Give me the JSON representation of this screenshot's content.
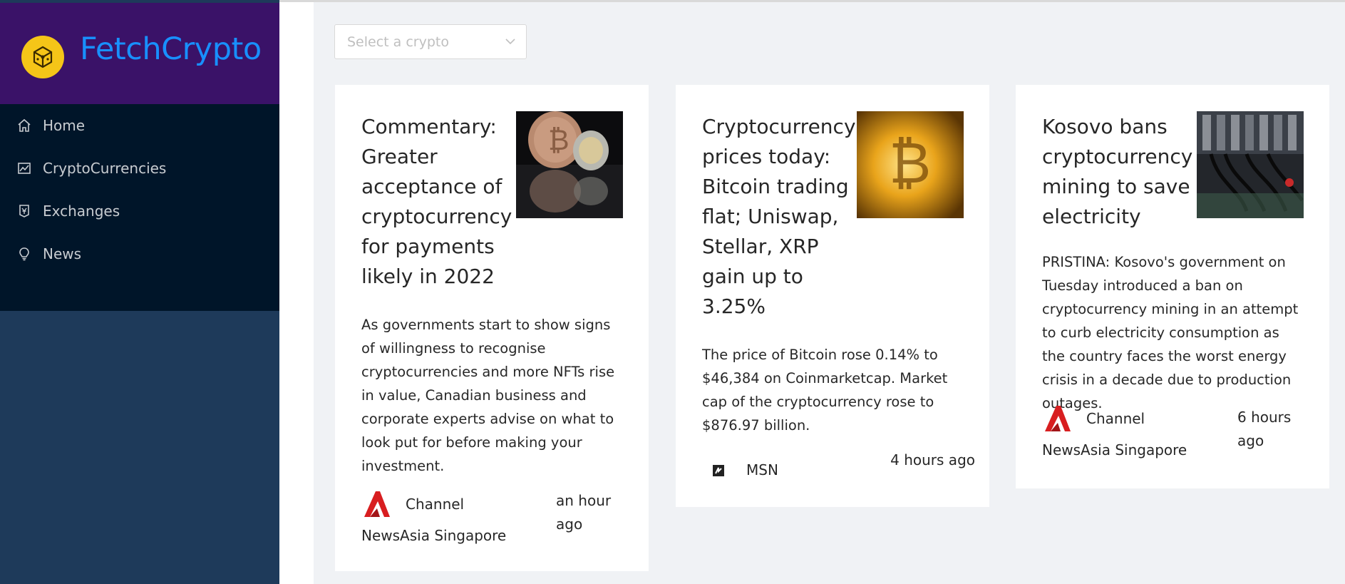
{
  "app": {
    "title": "FetchCrypto"
  },
  "colors": {
    "accent": "#1890ff",
    "logo_bg": "#3a1268",
    "menu_bg": "#001529",
    "sidebar_bg": "#1e3a5a",
    "logo_icon": "#f5c518"
  },
  "sidebar": {
    "items": [
      {
        "label": "Home",
        "icon": "home-icon"
      },
      {
        "label": "CryptoCurrencies",
        "icon": "fund-icon"
      },
      {
        "label": "Exchanges",
        "icon": "money-collect-icon"
      },
      {
        "label": "News",
        "icon": "bulb-icon"
      }
    ]
  },
  "filter": {
    "placeholder": "Select a crypto"
  },
  "news": [
    {
      "title": "Commentary: Greater acceptance of cryptocurrency for payments likely in 2022",
      "description": "As governments start to show signs of willingness to recognise cryptocurrencies and more NFTs rise in value, Canadian business and corporate experts advise on what to look put for before making your investment.",
      "provider": "Channel NewsAsia Singapore",
      "time": "an hour ago",
      "image": "bitcoin-coins-photo"
    },
    {
      "title": "Cryptocurrency prices today: Bitcoin trading flat; Uniswap, Stellar, XRP gain up to 3.25%",
      "description": "The price of Bitcoin rose 0.14% to $46,384 on Coinmarketcap. Market cap of the cryptocurrency rose to $876.97 billion.",
      "provider": "MSN",
      "time": "4 hours ago",
      "image": "golden-bitcoin-photo"
    },
    {
      "title": "Kosovo bans cryptocurrency mining to save electricity",
      "description": "PRISTINA: Kosovo's government on Tuesday introduced a ban on cryptocurrency mining in an attempt to curb electricity consumption as the country faces the worst energy crisis in a decade due to production outages.",
      "provider": "Channel NewsAsia Singapore",
      "time": "6 hours ago",
      "image": "mining-rig-photo"
    }
  ]
}
